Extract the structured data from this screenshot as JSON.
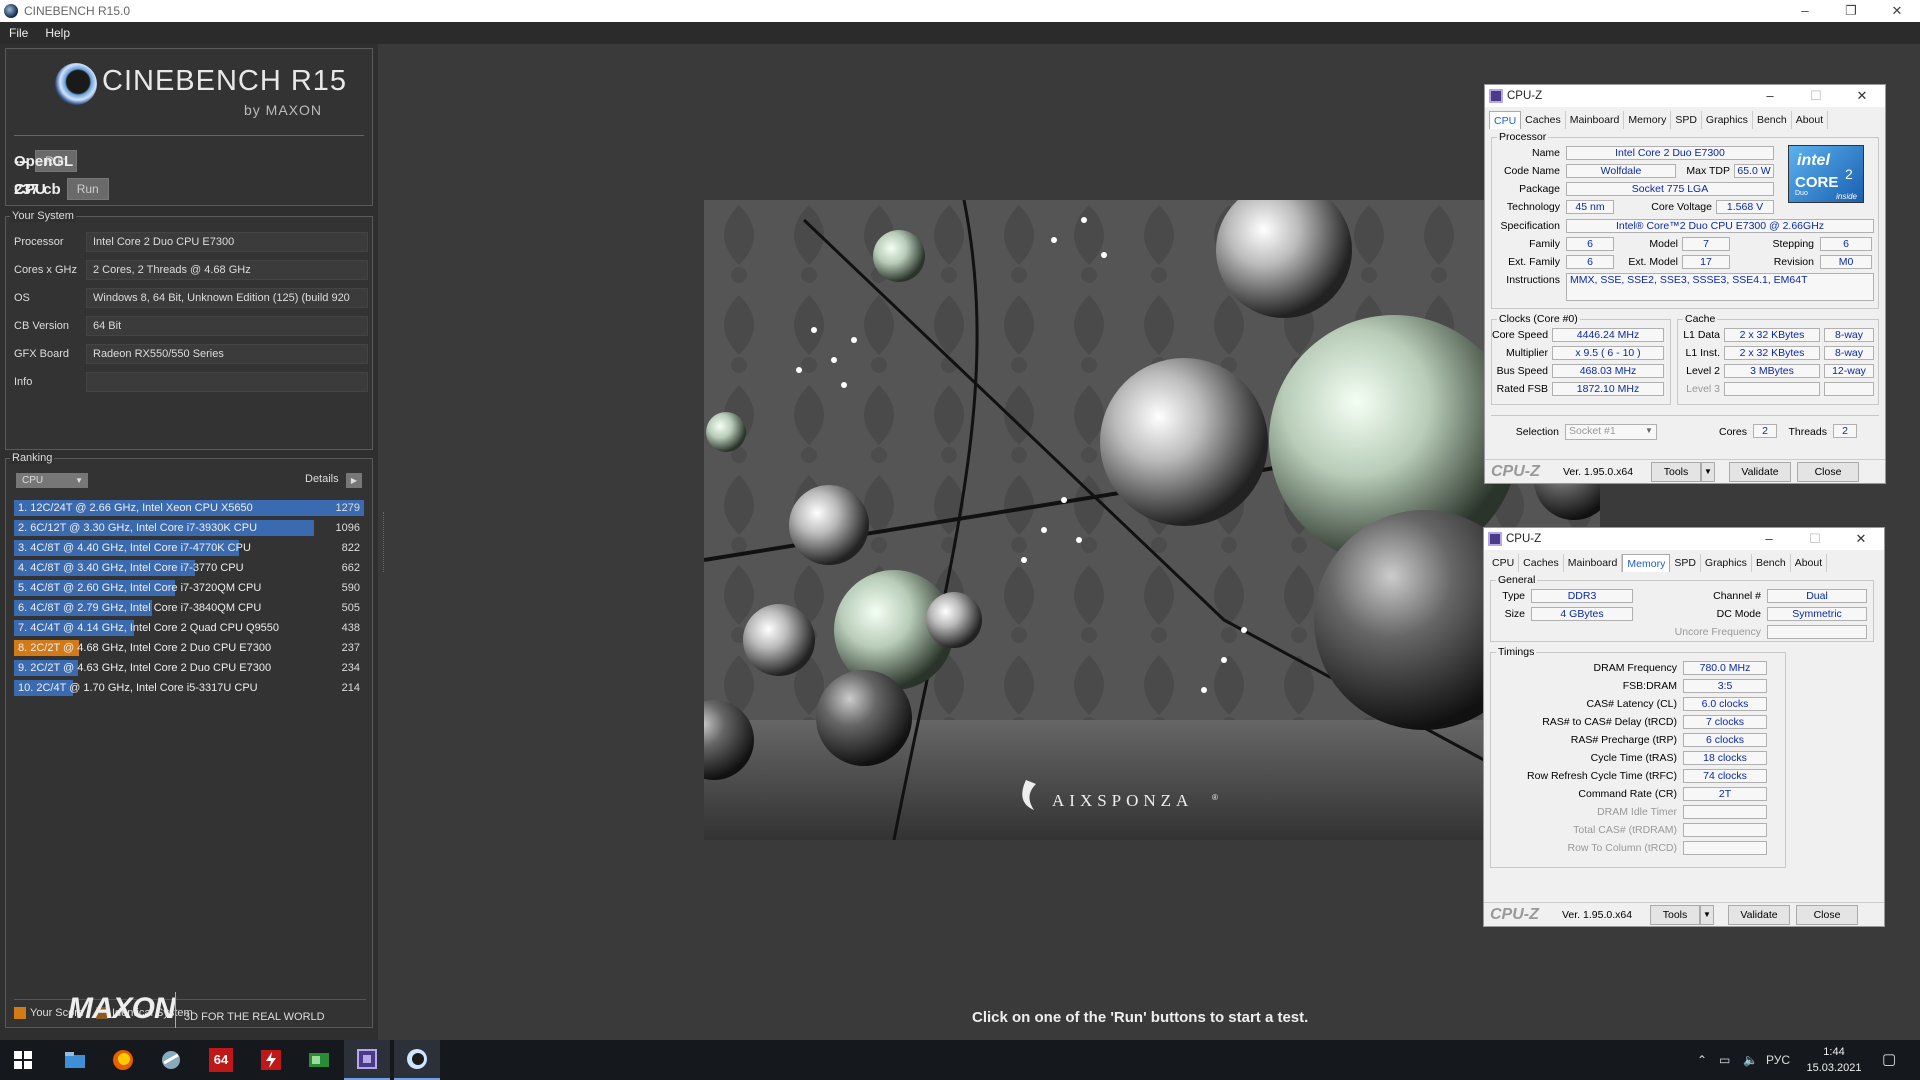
{
  "window": {
    "title": "CINEBENCH R15.0",
    "controls": [
      "–",
      "❐",
      "✕"
    ]
  },
  "menu": [
    "File",
    "Help"
  ],
  "logo": {
    "title": "CINEBENCH R15",
    "subtitle": "by MAXON"
  },
  "scores": {
    "opengl": {
      "label": "OpenGL",
      "value": "---",
      "run": "Run"
    },
    "cpu": {
      "label": "CPU",
      "value": "237 cb",
      "run": "Run"
    }
  },
  "system": {
    "title": "Your System",
    "rows": [
      {
        "key": "Processor",
        "value": "Intel Core 2 Duo CPU E7300"
      },
      {
        "key": "Cores x GHz",
        "value": "2 Cores, 2 Threads @ 4.68 GHz"
      },
      {
        "key": "OS",
        "value": "Windows 8, 64 Bit, Unknown Edition (125) (build 920"
      },
      {
        "key": "CB Version",
        "value": "64 Bit"
      },
      {
        "key": "GFX Board",
        "value": "Radeon RX550/550 Series"
      },
      {
        "key": "Info",
        "value": ""
      }
    ]
  },
  "ranking": {
    "title": "Ranking",
    "select": "CPU",
    "details": "Details",
    "max_score": 1279,
    "items": [
      {
        "label": "1. 12C/24T @ 2.66 GHz, Intel Xeon CPU X5650",
        "score": "1279",
        "value": 1279,
        "mine": false
      },
      {
        "label": "2. 6C/12T @ 3.30 GHz,  Intel Core i7-3930K CPU",
        "score": "1096",
        "value": 1096,
        "mine": false
      },
      {
        "label": "3. 4C/8T @ 4.40 GHz, Intel Core i7-4770K CPU",
        "score": "822",
        "value": 822,
        "mine": false
      },
      {
        "label": "4. 4C/8T @ 3.40 GHz,  Intel Core i7-3770 CPU",
        "score": "662",
        "value": 662,
        "mine": false
      },
      {
        "label": "5. 4C/8T @ 2.60 GHz, Intel Core i7-3720QM CPU",
        "score": "590",
        "value": 590,
        "mine": false
      },
      {
        "label": "6. 4C/8T @ 2.79 GHz,  Intel Core i7-3840QM CPU",
        "score": "505",
        "value": 505,
        "mine": false
      },
      {
        "label": "7. 4C/4T @ 4.14 GHz, Intel Core 2 Quad CPU Q9550",
        "score": "438",
        "value": 438,
        "mine": false
      },
      {
        "label": "8. 2C/2T @ 4.68 GHz, Intel Core 2 Duo CPU E7300",
        "score": "237",
        "value": 237,
        "mine": true
      },
      {
        "label": "9. 2C/2T @ 4.63 GHz, Intel Core 2 Duo CPU E7300",
        "score": "234",
        "value": 234,
        "mine": false
      },
      {
        "label": "10. 2C/4T @ 1.70 GHz,  Intel Core i5-3317U CPU",
        "score": "214",
        "value": 214,
        "mine": false
      }
    ],
    "legend": [
      {
        "label": "Your Score",
        "color": "#d27a18"
      },
      {
        "label": "Identical System",
        "color": "#8a5a20"
      }
    ]
  },
  "footer": {
    "brand": "MAXON",
    "tagline": "3D FOR THE REAL WORLD",
    "hint": "Click on one of the 'Run' buttons to start a test."
  },
  "render": {
    "watermark": "AIXSPONZA",
    "mark": "®"
  },
  "cpuz1": {
    "title": "CPU-Z",
    "tabs": [
      "CPU",
      "Caches",
      "Mainboard",
      "Memory",
      "SPD",
      "Graphics",
      "Bench",
      "About"
    ],
    "active_tab": "CPU",
    "processor": {
      "group": "Processor",
      "name_lbl": "Name",
      "name": "Intel Core 2 Duo E7300",
      "code_lbl": "Code Name",
      "code": "Wolfdale",
      "tdp_lbl": "Max TDP",
      "tdp": "65.0 W",
      "pkg_lbl": "Package",
      "pkg": "Socket 775 LGA",
      "tech_lbl": "Technology",
      "tech": "45 nm",
      "volt_lbl": "Core Voltage",
      "volt": "1.568 V",
      "spec_lbl": "Specification",
      "spec": "Intel® Core™2 Duo CPU     E7300  @ 2.66GHz",
      "fam_lbl": "Family",
      "fam": "6",
      "model_lbl": "Model",
      "model": "7",
      "step_lbl": "Stepping",
      "step": "6",
      "efam_lbl": "Ext. Family",
      "efam": "6",
      "emodel_lbl": "Ext. Model",
      "emodel": "17",
      "rev_lbl": "Revision",
      "rev": "M0",
      "inst_lbl": "Instructions",
      "inst": "MMX, SSE, SSE2, SSE3, SSSE3, SSE4.1, EM64T",
      "logo": {
        "a": "intel",
        "b": "CORE",
        "c": "Duo",
        "d": "inside",
        "sup": "2"
      }
    },
    "clocks": {
      "group": "Clocks (Core #0)",
      "speed_lbl": "Core Speed",
      "speed": "4446.24 MHz",
      "mult_lbl": "Multiplier",
      "mult": "x 9.5 ( 6 - 10 )",
      "bus_lbl": "Bus Speed",
      "bus": "468.03 MHz",
      "fsb_lbl": "Rated FSB",
      "fsb": "1872.10 MHz"
    },
    "cache": {
      "group": "Cache",
      "l1d_lbl": "L1 Data",
      "l1d": "2 x 32 KBytes",
      "l1d_w": "8-way",
      "l1i_lbl": "L1 Inst.",
      "l1i": "2 x 32 KBytes",
      "l1i_w": "8-way",
      "l2_lbl": "Level 2",
      "l2": "3 MBytes",
      "l2_w": "12-way",
      "l3_lbl": "Level 3"
    },
    "sel_lbl": "Selection",
    "sel": "Socket #1",
    "cores_lbl": "Cores",
    "cores": "2",
    "threads_lbl": "Threads",
    "threads": "2",
    "footer": {
      "brand": "CPU-Z",
      "version": "Ver. 1.95.0.x64",
      "tools": "Tools",
      "validate": "Validate",
      "close": "Close"
    }
  },
  "cpuz2": {
    "title": "CPU-Z",
    "tabs": [
      "CPU",
      "Caches",
      "Mainboard",
      "Memory",
      "SPD",
      "Graphics",
      "Bench",
      "About"
    ],
    "active_tab": "Memory",
    "general": {
      "group": "General",
      "type_lbl": "Type",
      "type": "DDR3",
      "size_lbl": "Size",
      "size": "4 GBytes",
      "chan_lbl": "Channel #",
      "chan": "Dual",
      "dc_lbl": "DC Mode",
      "dc": "Symmetric",
      "unc_lbl": "Uncore Frequency"
    },
    "timings": {
      "group": "Timings",
      "rows": [
        {
          "label": "DRAM Frequency",
          "value": "780.0 MHz",
          "dis": false
        },
        {
          "label": "FSB:DRAM",
          "value": "3:5",
          "dis": false
        },
        {
          "label": "CAS# Latency (CL)",
          "value": "6.0 clocks",
          "dis": false
        },
        {
          "label": "RAS# to CAS# Delay (tRCD)",
          "value": "7 clocks",
          "dis": false
        },
        {
          "label": "RAS# Precharge (tRP)",
          "value": "6 clocks",
          "dis": false
        },
        {
          "label": "Cycle Time (tRAS)",
          "value": "18 clocks",
          "dis": false
        },
        {
          "label": "Row Refresh Cycle Time (tRFC)",
          "value": "74 clocks",
          "dis": false
        },
        {
          "label": "Command Rate (CR)",
          "value": "2T",
          "dis": false
        },
        {
          "label": "DRAM Idle Timer",
          "value": "",
          "dis": true
        },
        {
          "label": "Total CAS# (tRDRAM)",
          "value": "",
          "dis": true
        },
        {
          "label": "Row To Column (tRCD)",
          "value": "",
          "dis": true
        }
      ]
    },
    "footer": {
      "brand": "CPU-Z",
      "version": "Ver. 1.95.0.x64",
      "tools": "Tools",
      "validate": "Validate",
      "close": "Close"
    }
  },
  "taskbar": {
    "lang": "РУС",
    "time": "1:44",
    "date": "15.03.2021",
    "icons": [
      "windows-start-icon",
      "file-explorer-icon",
      "firefox-icon",
      "app-tool-icon",
      "aida64-icon",
      "flash-icon",
      "gpu-z-icon",
      "cpu-z-icon",
      "cinebench-icon"
    ],
    "aida_label": "64"
  }
}
